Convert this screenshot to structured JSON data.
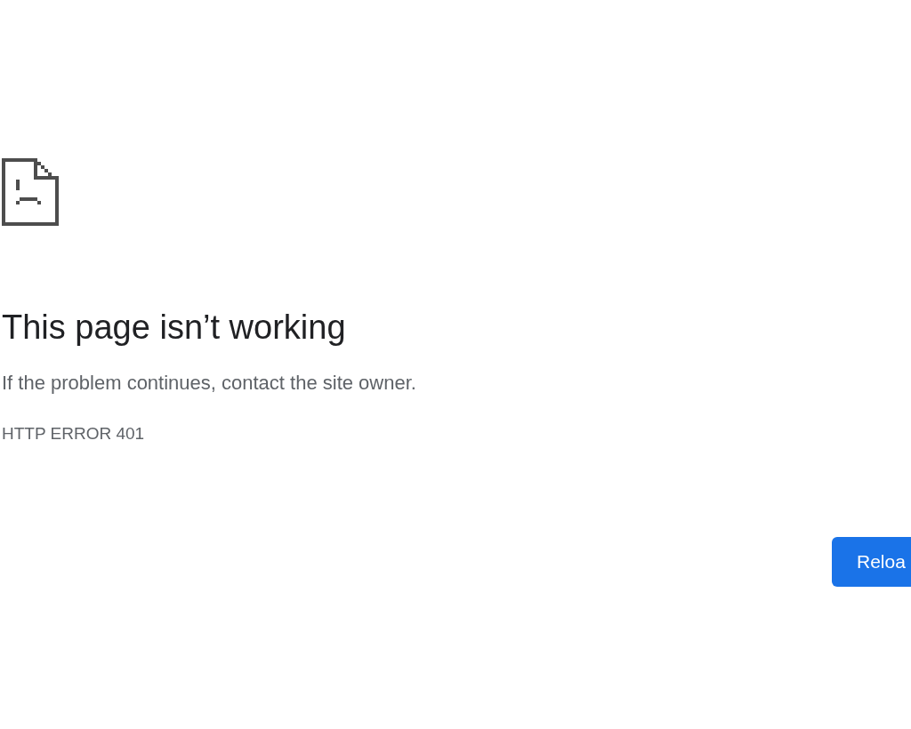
{
  "heading": "This page isn’t working",
  "message": "If the problem continues, contact the site owner.",
  "error_code": "HTTP ERROR 401",
  "buttons": [
    {
      "label": "Reloa"
    }
  ]
}
